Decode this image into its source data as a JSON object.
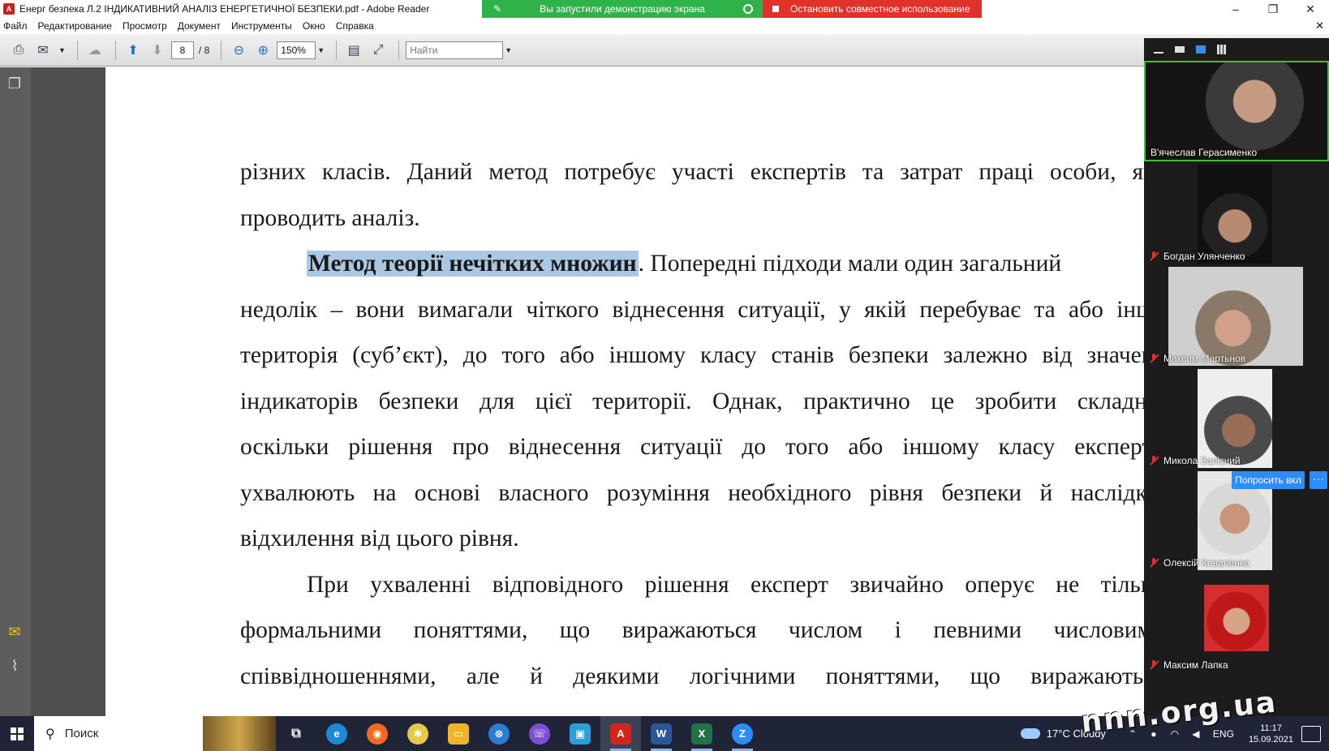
{
  "window": {
    "title": "Енерг безпека Л.2 ІНДИКАТИВНИЙ АНАЛІЗ ЕНЕРГЕТИЧНОЇ БЕЗПЕКИ.pdf - Adobe Reader",
    "share_banner": "Вы запустили демонстрацию экрана",
    "stop_share": "Остановить совместное использование"
  },
  "menu": [
    "Файл",
    "Редактирование",
    "Просмотр",
    "Документ",
    "Инструменты",
    "Окно",
    "Справка"
  ],
  "toolbar": {
    "page_current": "8",
    "page_total": "/ 8",
    "zoom": "150%",
    "find_placeholder": "Найти"
  },
  "document": {
    "lines": [
      "різних класів. Даний метод потребує участі експертів та затрат праці особи, яка",
      "проводить аналіз.",
      "недолік – вони вимагали чіткого віднесення ситуації, у якій перебуває та або інша",
      "територія (суб’єкт), до того або іншому класу станів безпеки залежно від значень",
      "індикаторів безпеки для цієї території. Однак, практично це зробити складно,",
      "оскільки рішення про віднесення ситуації до того або іншому класу експерти",
      "ухвалюють на основі власного розуміння необхідного рівня безпеки й наслідків",
      "відхилення від цього рівня.",
      "При ухваленні відповідного рішення експерт звичайно оперує не тільки",
      "формальними поняттями, що виражаються числом і певними числовими",
      "співвідношеннями, але й деякими логічними поняттями, що виражаються"
    ],
    "highlight": "Метод теорії нечітких множин",
    "highlight_tail": ". Попередні підходи мали один загальний"
  },
  "participants": [
    {
      "name": "В'ячеслав Герасименко",
      "muted": false
    },
    {
      "name": "Богдан Улянченко",
      "muted": true
    },
    {
      "name": "Максим Мартьнов",
      "muted": true
    },
    {
      "name": "Микола Залізний",
      "muted": true
    },
    {
      "name": "Олексій Коваленко",
      "muted": true
    },
    {
      "name": "Максим Лапка",
      "muted": true
    }
  ],
  "zoom_panel": {
    "ask_button": "Попросить вкл",
    "more_button": "···"
  },
  "taskbar": {
    "search": "Поиск",
    "weather": "17°C  Cloudy",
    "lang": "ENG",
    "time": "11:17",
    "date": "15.09.2021"
  },
  "watermark": "nnn.org.ua",
  "colors": {
    "share_green": "#2fb24a",
    "stop_red": "#e0322b",
    "highlight": "#aac8e4",
    "zoom_blue": "#2d8cff",
    "taskbar": "#1f2536"
  }
}
